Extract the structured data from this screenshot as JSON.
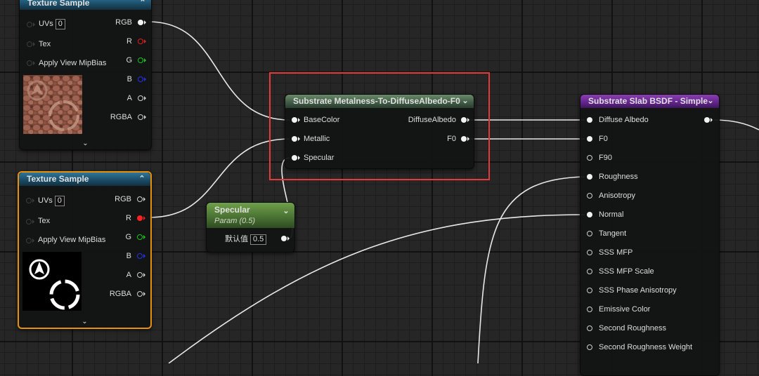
{
  "texture_sample_1": {
    "title": "Texture Sample",
    "inputs": [
      {
        "label": "UVs",
        "value": "0"
      },
      {
        "label": "Tex"
      },
      {
        "label": "Apply View MipBias"
      }
    ],
    "outputs": [
      "RGB",
      "R",
      "G",
      "B",
      "A",
      "RGBA"
    ],
    "thumbnail": "cobblestone-texture"
  },
  "texture_sample_2": {
    "title": "Texture Sample",
    "inputs": [
      {
        "label": "UVs",
        "value": "0"
      },
      {
        "label": "Tex"
      },
      {
        "label": "Apply View MipBias"
      }
    ],
    "outputs": [
      "RGB",
      "R",
      "G",
      "B",
      "A",
      "RGBA"
    ],
    "thumbnail": "mask-texture"
  },
  "metalness_node": {
    "title": "Substrate Metalness-To-DiffuseAlbedo-F0",
    "inputs": [
      "BaseColor",
      "Metallic",
      "Specular"
    ],
    "outputs": [
      "DiffuseAlbedo",
      "F0"
    ]
  },
  "specular_node": {
    "title": "Specular",
    "subtitle": "Param (0.5)",
    "default_label": "默认值",
    "default_value": "0.5"
  },
  "slab_node": {
    "title": "Substrate Slab BSDF - Simple",
    "inputs": [
      "Diffuse Albedo",
      "F0",
      "F90",
      "Roughness",
      "Anisotropy",
      "Normal",
      "Tangent",
      "SSS MFP",
      "SSS MFP Scale",
      "SSS Phase Anisotropy",
      "Emissive Color",
      "Second Roughness",
      "Second Roughness Weight"
    ]
  },
  "colors": {
    "selection_outline": "#e6900f",
    "highlight_box": "#e63b3b",
    "texture_header": "#1a4a64",
    "substrate_header": "#3f5a44",
    "slab_header": "#61248a",
    "param_header": "#486f32"
  }
}
